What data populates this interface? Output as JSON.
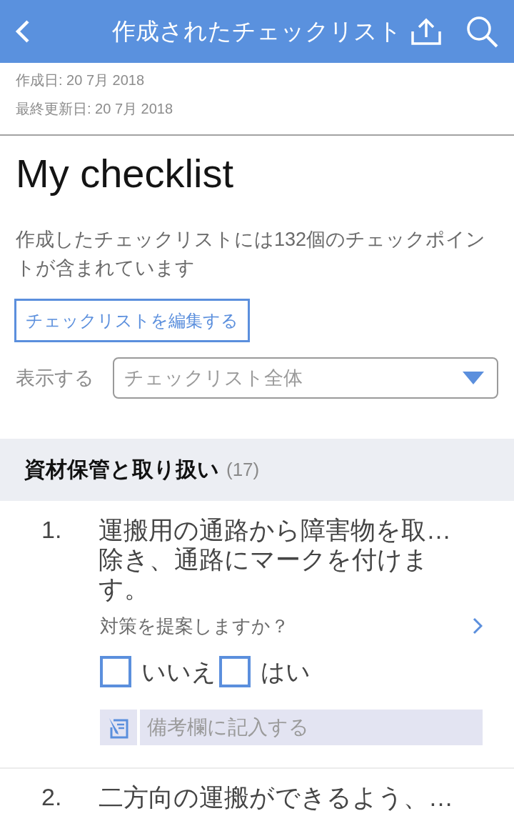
{
  "header": {
    "title": "作成されたチェックリスト"
  },
  "meta_lines": [
    "作成日: 20 7月 2018",
    "最終更新日: 20 7月 2018"
  ],
  "checklist": {
    "title": "My checklist",
    "description": "作成したチェックリストには132個のチェックポイントが含まれています",
    "edit_button": "チェックリストを編集する"
  },
  "view_filter": {
    "label": "表示する",
    "value": "チェックリスト全体"
  },
  "sections": [
    {
      "title": "資材保管と取り扱い",
      "count": "(17)",
      "items": [
        {
          "number": "1.",
          "text": "運搬用の通路から障害物を取…\n除き、通路にマークを付けます。",
          "question": "対策を提案しますか？",
          "options": [
            {
              "label": "いいえ",
              "checked": false
            },
            {
              "label": "はい",
              "checked": false
            }
          ],
          "notes": {
            "placeholder": "備考欄に記入する"
          }
        },
        {
          "number": "2.",
          "text": "二方向の運搬ができるよう、…"
        }
      ]
    }
  ]
}
